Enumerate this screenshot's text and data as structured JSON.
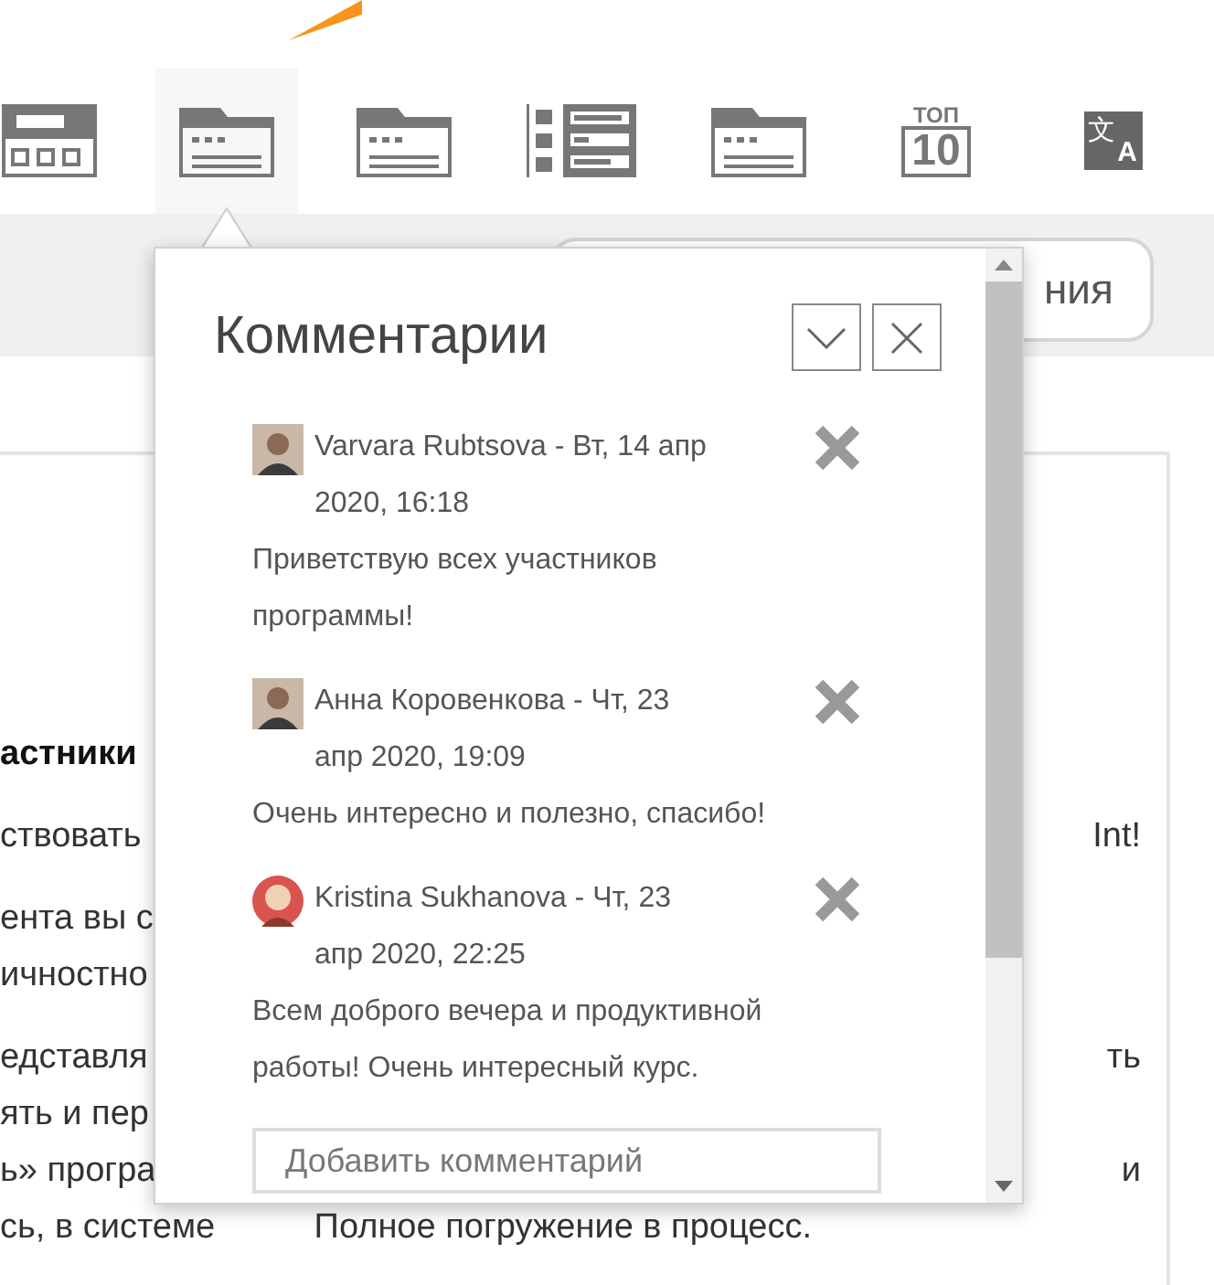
{
  "toolbar": [
    {
      "kind": "form",
      "selected": false
    },
    {
      "kind": "folder",
      "selected": true
    },
    {
      "kind": "folder",
      "selected": false
    },
    {
      "kind": "list",
      "selected": false
    },
    {
      "kind": "folder",
      "selected": false
    },
    {
      "kind": "top",
      "selected": false,
      "top": "ТОП",
      "number": "10"
    },
    {
      "kind": "translate",
      "selected": false,
      "glyph": "文",
      "letter": "A"
    }
  ],
  "band_button": {
    "label": "ния"
  },
  "background_text": [
    {
      "lines": [
        {
          "left": "астники",
          "bold": true
        }
      ]
    },
    {
      "lines": [
        {
          "left": "ствовать",
          "right": "Int!"
        }
      ]
    },
    {
      "lines": [
        {
          "left": "ента вы с"
        },
        {
          "left": "ичностно"
        }
      ]
    },
    {
      "lines": [
        {
          "left": "едставля",
          "right": "ть"
        },
        {
          "left": "ять и пер"
        },
        {
          "left": "ь» програ",
          "right": "и"
        },
        {
          "left": "сь, в системе",
          "right": "Полное погружение в процесс."
        }
      ]
    }
  ],
  "comments_panel": {
    "title": "Комментарии",
    "comments": [
      {
        "kind": "square",
        "header": "Varvara Rubtsova - Вт, 14 апр 2020, 16:18",
        "text": "Приветствую всех участников программы!"
      },
      {
        "kind": "square",
        "header": "Анна Коровенкова - Чт, 23 апр 2020, 19:09",
        "text": "Очень интересно и полезно, спасибо!"
      },
      {
        "kind": "round",
        "header": "Kristina Sukhanova - Чт, 23 апр 2020, 22:25",
        "text": "Всем доброго вечера и продуктивной работы! Очень интересный курс."
      }
    ],
    "input": {
      "placeholder": "Добавить комментарий"
    }
  }
}
